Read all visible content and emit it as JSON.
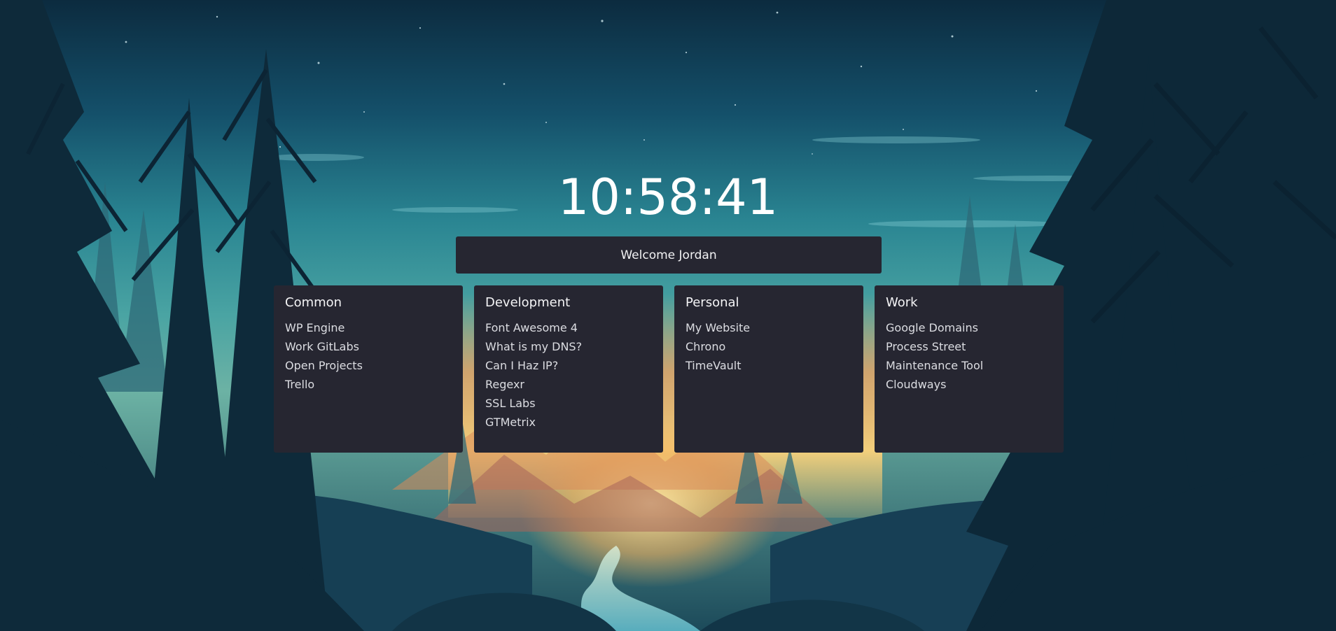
{
  "clock": {
    "time": "10:58:41"
  },
  "welcome": {
    "text": "Welcome Jordan"
  },
  "colors": {
    "card_background": "#262631",
    "text": "#dcdde2",
    "sky_top": "#0b2a3e",
    "sky_horizon": "#3c9aa0",
    "sunset": "#f2b25a"
  },
  "background": {
    "image": "forest-night-landscape"
  },
  "cards": [
    {
      "title": "Common",
      "links": [
        "WP Engine",
        "Work GitLabs",
        "Open Projects",
        "Trello"
      ]
    },
    {
      "title": "Development",
      "links": [
        "Font Awesome 4",
        "What is my DNS?",
        "Can I Haz IP?",
        "Regexr",
        "SSL Labs",
        "GTMetrix"
      ]
    },
    {
      "title": "Personal",
      "links": [
        "My Website",
        "Chrono",
        "TimeVault"
      ]
    },
    {
      "title": "Work",
      "links": [
        "Google Domains",
        "Process Street",
        "Maintenance Tool",
        "Cloudways"
      ]
    }
  ]
}
